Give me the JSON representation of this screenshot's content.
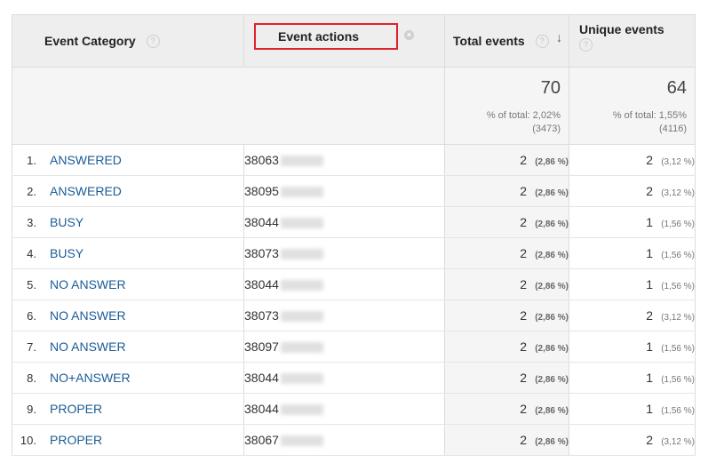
{
  "header": {
    "event_category": "Event Category",
    "event_actions": "Event actions",
    "total_events": "Total events",
    "unique_events": "Unique events",
    "help_glyph": "?",
    "remove_glyph": "×",
    "sort_glyph": "↓"
  },
  "summary": {
    "total_events": {
      "value": "70",
      "pct": "% of total: 2,02%",
      "of_total": "(3473)"
    },
    "unique_events": {
      "value": "64",
      "pct": "% of total: 1,55%",
      "of_total": "(4116)"
    }
  },
  "rows": [
    {
      "index": "1.",
      "category": "ANSWERED",
      "action": "38063",
      "total": "2",
      "total_pct": "(2,86 %)",
      "unique": "2",
      "unique_pct": "(3,12 %)"
    },
    {
      "index": "2.",
      "category": "ANSWERED",
      "action": "38095",
      "total": "2",
      "total_pct": "(2,86 %)",
      "unique": "2",
      "unique_pct": "(3,12 %)"
    },
    {
      "index": "3.",
      "category": "BUSY",
      "action": "38044",
      "total": "2",
      "total_pct": "(2,86 %)",
      "unique": "1",
      "unique_pct": "(1,56 %)"
    },
    {
      "index": "4.",
      "category": "BUSY",
      "action": "38073",
      "total": "2",
      "total_pct": "(2,86 %)",
      "unique": "1",
      "unique_pct": "(1,56 %)"
    },
    {
      "index": "5.",
      "category": "NO ANSWER",
      "action": "38044",
      "total": "2",
      "total_pct": "(2,86 %)",
      "unique": "1",
      "unique_pct": "(1,56 %)"
    },
    {
      "index": "6.",
      "category": "NO ANSWER",
      "action": "38073",
      "total": "2",
      "total_pct": "(2,86 %)",
      "unique": "2",
      "unique_pct": "(3,12 %)"
    },
    {
      "index": "7.",
      "category": "NO ANSWER",
      "action": "38097",
      "total": "2",
      "total_pct": "(2,86 %)",
      "unique": "1",
      "unique_pct": "(1,56 %)"
    },
    {
      "index": "8.",
      "category": "NO+ANSWER",
      "action": "38044",
      "total": "2",
      "total_pct": "(2,86 %)",
      "unique": "1",
      "unique_pct": "(1,56 %)"
    },
    {
      "index": "9.",
      "category": "PROPER",
      "action": "38044",
      "total": "2",
      "total_pct": "(2,86 %)",
      "unique": "1",
      "unique_pct": "(1,56 %)"
    },
    {
      "index": "10.",
      "category": "PROPER",
      "action": "38067",
      "total": "2",
      "total_pct": "(2,86 %)",
      "unique": "2",
      "unique_pct": "(3,12 %)"
    }
  ],
  "colors": {
    "link": "#1a5c96",
    "highlight_border": "#e0222a",
    "header_bg": "#eeeeee"
  }
}
